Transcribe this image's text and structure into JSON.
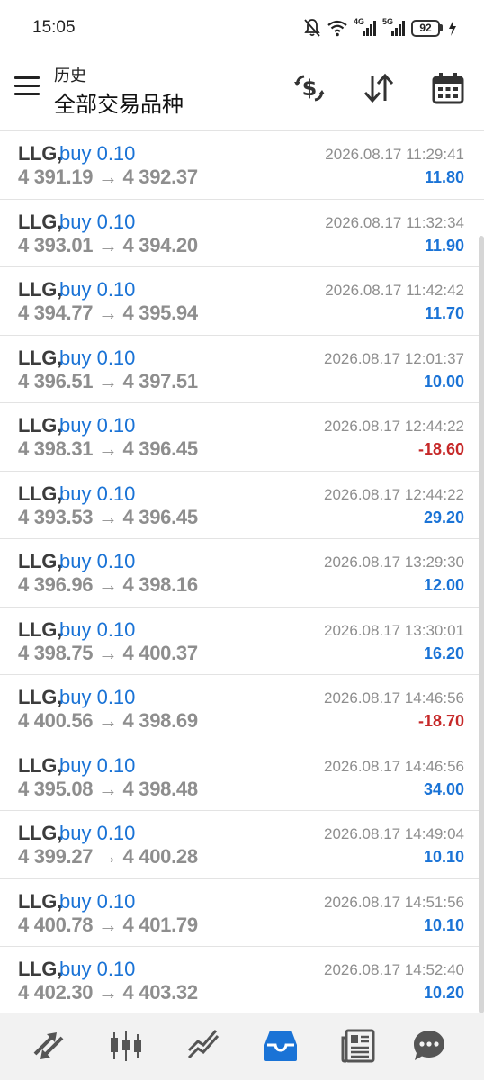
{
  "status_bar": {
    "time": "15:05",
    "network_1": "4G",
    "network_2": "5G",
    "battery": "92"
  },
  "header": {
    "subtitle": "历史",
    "title": "全部交易品种"
  },
  "colors": {
    "profit_positive": "#1a73d6",
    "profit_negative": "#c62828",
    "accent": "#1a73d6"
  },
  "trades": [
    {
      "symbol": "LLG,",
      "trade": "buy 0.10",
      "prices": "4 391.19 → 4 392.37",
      "time": "2026.08.17 11:29:41",
      "profit": "11.80",
      "negative": false
    },
    {
      "symbol": "LLG,",
      "trade": "buy 0.10",
      "prices": "4 393.01 → 4 394.20",
      "time": "2026.08.17 11:32:34",
      "profit": "11.90",
      "negative": false
    },
    {
      "symbol": "LLG,",
      "trade": "buy 0.10",
      "prices": "4 394.77 → 4 395.94",
      "time": "2026.08.17 11:42:42",
      "profit": "11.70",
      "negative": false
    },
    {
      "symbol": "LLG,",
      "trade": "buy 0.10",
      "prices": "4 396.51 → 4 397.51",
      "time": "2026.08.17 12:01:37",
      "profit": "10.00",
      "negative": false
    },
    {
      "symbol": "LLG,",
      "trade": "buy 0.10",
      "prices": "4 398.31 → 4 396.45",
      "time": "2026.08.17 12:44:22",
      "profit": "-18.60",
      "negative": true
    },
    {
      "symbol": "LLG,",
      "trade": "buy 0.10",
      "prices": "4 393.53 → 4 396.45",
      "time": "2026.08.17 12:44:22",
      "profit": "29.20",
      "negative": false
    },
    {
      "symbol": "LLG,",
      "trade": "buy 0.10",
      "prices": "4 396.96 → 4 398.16",
      "time": "2026.08.17 13:29:30",
      "profit": "12.00",
      "negative": false
    },
    {
      "symbol": "LLG,",
      "trade": "buy 0.10",
      "prices": "4 398.75 → 4 400.37",
      "time": "2026.08.17 13:30:01",
      "profit": "16.20",
      "negative": false
    },
    {
      "symbol": "LLG,",
      "trade": "buy 0.10",
      "prices": "4 400.56 → 4 398.69",
      "time": "2026.08.17 14:46:56",
      "profit": "-18.70",
      "negative": true
    },
    {
      "symbol": "LLG,",
      "trade": "buy 0.10",
      "prices": "4 395.08 → 4 398.48",
      "time": "2026.08.17 14:46:56",
      "profit": "34.00",
      "negative": false
    },
    {
      "symbol": "LLG,",
      "trade": "buy 0.10",
      "prices": "4 399.27 → 4 400.28",
      "time": "2026.08.17 14:49:04",
      "profit": "10.10",
      "negative": false
    },
    {
      "symbol": "LLG,",
      "trade": "buy 0.10",
      "prices": "4 400.78 → 4 401.79",
      "time": "2026.08.17 14:51:56",
      "profit": "10.10",
      "negative": false
    },
    {
      "symbol": "LLG,",
      "trade": "buy 0.10",
      "prices": "4 402.30 → 4 403.32",
      "time": "2026.08.17 14:52:40",
      "profit": "10.20",
      "negative": false
    }
  ],
  "toolbar_icons": [
    "currency-exchange-icon",
    "sort-icon",
    "calendar-icon"
  ],
  "bottom_nav": {
    "items": [
      "quotes-icon",
      "chart-icon",
      "trade-icon",
      "history-icon",
      "news-icon",
      "chat-icon"
    ],
    "active": "history-icon"
  }
}
